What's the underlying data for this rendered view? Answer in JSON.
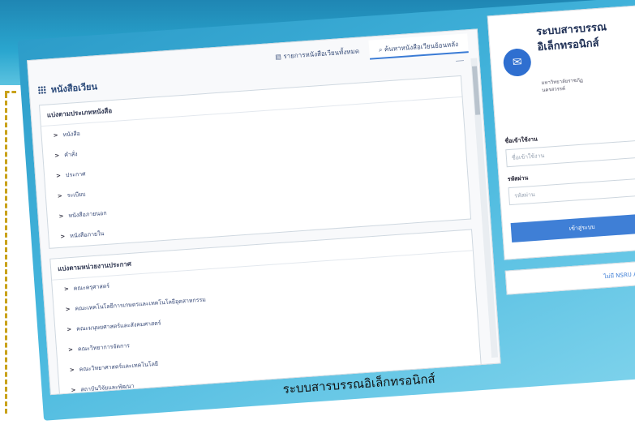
{
  "main": {
    "title": "หนังสือเวียน",
    "tabs": [
      {
        "label": "รายการหนังสือเวียนทั้งหมด"
      },
      {
        "label": "ค้นหาหนังสือเวียนย้อนหลัง"
      }
    ],
    "section1": {
      "header": "แบ่งตามประเภทหนังสือ",
      "items": [
        "หนังสือ",
        "คำสั่ง",
        "ประกาศ",
        "ระเบียบ",
        "หนังสือภายนอก",
        "หนังสือภายใน"
      ]
    },
    "section2": {
      "header": "แบ่งตามหน่วยงานประกาศ",
      "items": [
        "คณะครุศาสตร์",
        "คณะเทคโนโลยีการเกษตรและเทคโนโลยีอุตสาหกรรม",
        "คณะมนุษยศาสตร์และสังคมศาสตร์",
        "คณะวิทยาการจัดการ",
        "คณะวิทยาศาสตร์และเทคโนโลยี",
        "สถาบันวิจัยและพัฒนา"
      ]
    }
  },
  "login": {
    "system_title": "ระบบสารบรรณอิเล็กทรอนิกส์",
    "org": "มหาวิทยาลัยราชภัฏนครสวรรค์",
    "username_label": "ชื่อเข้าใช้งาน",
    "username_placeholder": "ชื่อเข้าใช้งาน",
    "password_label": "รหัสผ่าน",
    "password_placeholder": "รหัสผ่าน",
    "login_button": "เข้าสู่ระบบ",
    "nsru_link": "ไม่มี NSRU Account"
  },
  "caption": "ระบบสารบรรณอิเล็กทรอนิกส์",
  "colors": {
    "accent": "#3f7fd6",
    "banner": "#2aa6cf"
  }
}
